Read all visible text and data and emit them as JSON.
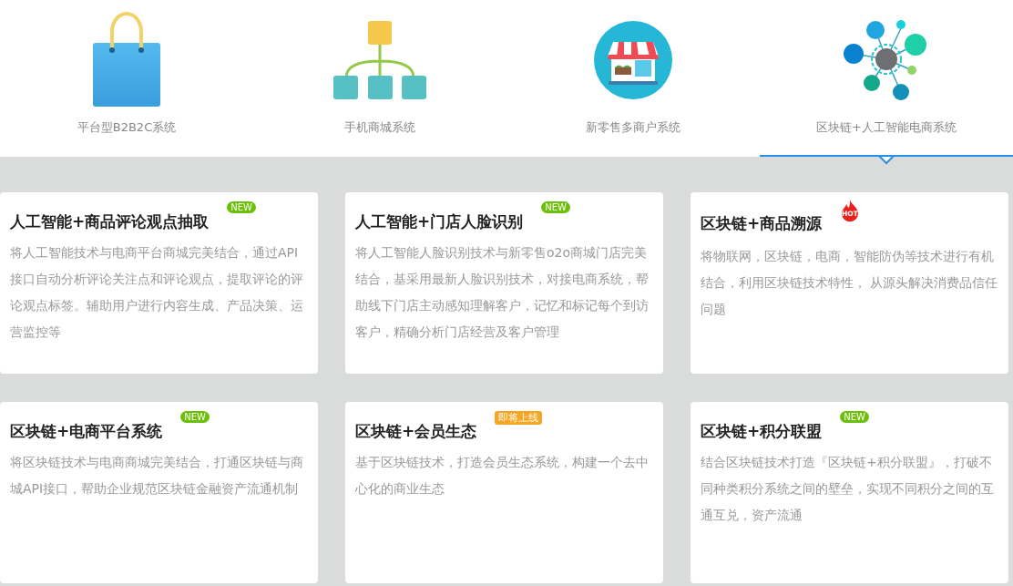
{
  "tabs": [
    {
      "label": "平台型B2B2C系统",
      "kind": "bag",
      "selected": false
    },
    {
      "label": "手机商城系统",
      "kind": "tree",
      "selected": false
    },
    {
      "label": "新零售多商户系统",
      "kind": "store",
      "selected": false
    },
    {
      "label": "区块链+人工智能电商系统",
      "kind": "network",
      "selected": true
    }
  ],
  "cards": [
    {
      "title": "人工智能+商品评论观点抽取",
      "badge": {
        "kind": "new",
        "label": "NEW"
      },
      "description": "将人工智能技术与电商平台商城完美结合，通过API接口自动分析评论关注点和评论观点，提取评论的评论观点标签。辅助用户进行内容生成、产品决策、运营监控等"
    },
    {
      "title": "人工智能+门店人脸识别",
      "badge": {
        "kind": "new",
        "label": "NEW"
      },
      "description": "将人工智能人脸识别技术与新零售o2o商城门店完美结合，基采用最新人脸识别技术，对接电商系统，帮助线下门店主动感知理解客户，记忆和标记每个到访客户，精确分析门店经营及客户管理"
    },
    {
      "title": "区块链+商品溯源",
      "badge": {
        "kind": "hot",
        "label": "HOT"
      },
      "description": "将物联网，区块链，电商，智能防伪等技术进行有机结合，利用区块链技术特性， 从源头解决消费品信任问题"
    },
    {
      "title": "区块链+电商平台系统",
      "badge": {
        "kind": "new",
        "label": "NEW"
      },
      "description": "将区块链技术与电商商城完美结合，打通区块链与商城API接口，帮助企业规范区块链金融资产流通机制"
    },
    {
      "title": "区块链+会员生态",
      "badge": {
        "kind": "soon",
        "label": "即将上线"
      },
      "description": "基于区块链技术，打造会员生态系统，构建一个去中心化的商业生态"
    },
    {
      "title": "区块链+积分联盟",
      "badge": {
        "kind": "new",
        "label": "NEW"
      },
      "description": "结合区块链技术打造『区块链+积分联盟』，打破不同种类积分系统之间的壁垒，实现不同积分之间的互通互兑，资产流通"
    }
  ]
}
